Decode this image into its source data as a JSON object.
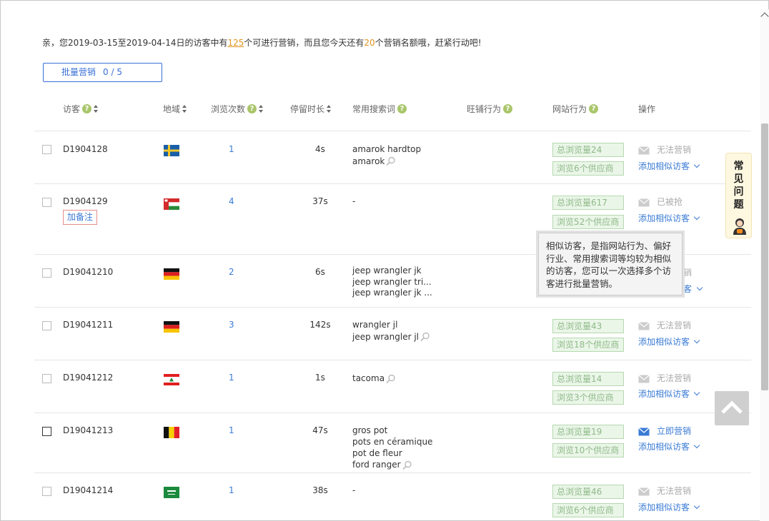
{
  "notice": {
    "p1": "亲，您2019-03-15至2019-04-14日的访客中有",
    "count": "125",
    "p2": "个可进行营销，而且您今天还有",
    "remaining": "20",
    "p3": "个营销名额哦，赶紧行动吧!"
  },
  "batch": {
    "label": "批量营销",
    "count": "0 / 5"
  },
  "headers": {
    "visitor": "访客",
    "region": "地域",
    "visits": "浏览次数",
    "stay": "停留时长",
    "keywords": "常用搜索词",
    "wangpu": "旺铺行为",
    "site": "网站行为",
    "action": "操作"
  },
  "rows": [
    {
      "id": "D1904128",
      "flag": "sweden",
      "visits": "1",
      "stay": "4s",
      "keywords": [
        "amarok hardtop",
        "amarok"
      ],
      "total": "总浏览量24",
      "suppliers": "浏览6个供应商",
      "op": "无法营销",
      "op_state": "gray",
      "similar": "添加相似访客"
    },
    {
      "id": "D1904129",
      "flag": "oman",
      "visits": "4",
      "stay": "37s",
      "keywords": [
        "-"
      ],
      "note": "加备注",
      "total": "总浏览量617",
      "suppliers": "浏览52个供应商",
      "op": "已被抢",
      "op_state": "gray",
      "similar": "添加相似访客"
    },
    {
      "id": "D19041210",
      "flag": "germany",
      "visits": "2",
      "stay": "6s",
      "keywords": [
        "jeep wrangler jk",
        "jeep wrangler tri...",
        "jeep wrangler jk ..."
      ],
      "total": "",
      "suppliers": "",
      "op": "",
      "op_state": "gray",
      "similar": ""
    },
    {
      "id": "D19041211",
      "flag": "germany",
      "visits": "3",
      "stay": "142s",
      "keywords": [
        "wrangler jl",
        "jeep wrangler jl"
      ],
      "total": "总浏览量43",
      "suppliers": "浏览18个供应商",
      "op": "无法营销",
      "op_state": "gray",
      "similar": "添加相似访客"
    },
    {
      "id": "D19041212",
      "flag": "lebanon",
      "visits": "1",
      "stay": "1s",
      "keywords": [
        "tacoma"
      ],
      "total": "总浏览量14",
      "suppliers": "浏览3个供应商",
      "op": "无法营销",
      "op_state": "gray",
      "similar": "添加相似访客"
    },
    {
      "id": "D19041213",
      "flag": "belgium",
      "visits": "1",
      "stay": "47s",
      "keywords": [
        "gros pot",
        "pots en céramique",
        "pot de fleur",
        "ford ranger"
      ],
      "total": "总浏览量19",
      "suppliers": "浏览10个供应商",
      "op": "立即营销",
      "op_state": "blue",
      "similar": "添加相似访客"
    },
    {
      "id": "D19041214",
      "flag": "saudi-arabia",
      "visits": "1",
      "stay": "38s",
      "keywords": [
        "-"
      ],
      "total": "总浏览量46",
      "suppliers": "浏览6个供应商",
      "op": "无法营销",
      "op_state": "gray",
      "similar": "添加相似访客"
    }
  ],
  "tooltip": "相似访客，是指网站行为、偏好行业、常用搜索词等均较为相似的访客，您可以一次选择多个访客进行批量营销。",
  "faq": {
    "label": "常见问题"
  },
  "colors": {
    "accent": "#3a6fd6",
    "highlight": "#e0931f",
    "tag_bg": "#eaf6e8"
  }
}
